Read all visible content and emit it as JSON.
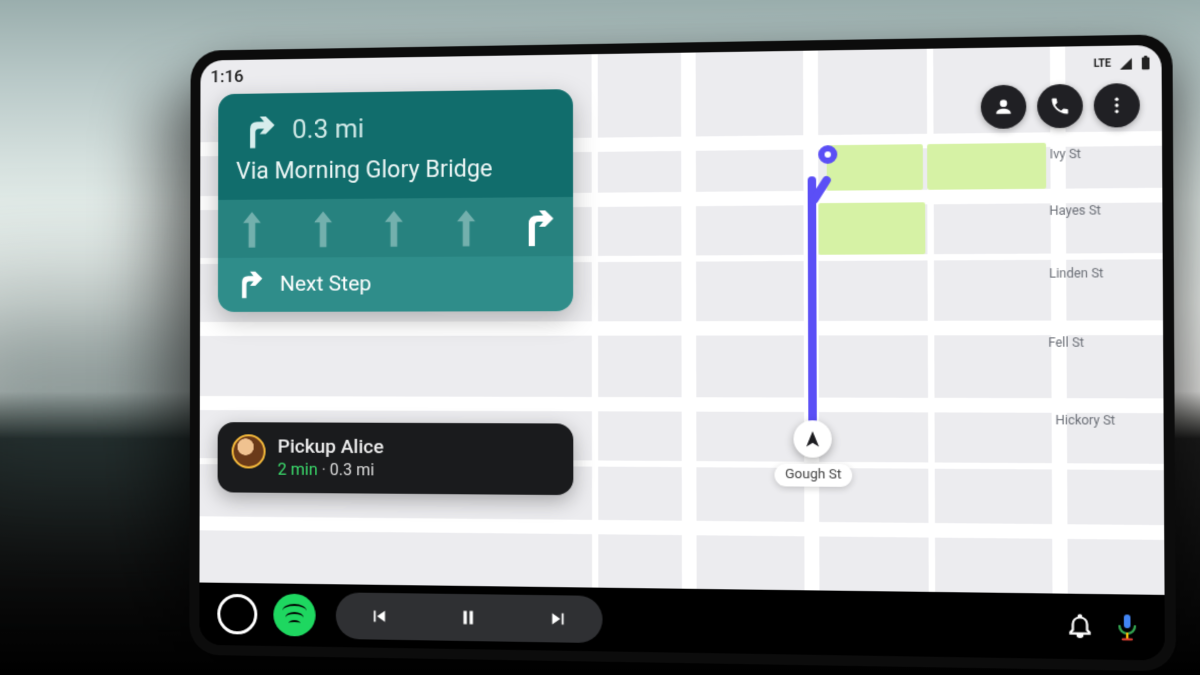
{
  "status": {
    "time": "1:16",
    "network": "LTE"
  },
  "nav": {
    "distance": "0.3 mi",
    "via": "Via Morning Glory Bridge",
    "next_step_label": "Next Step"
  },
  "pickup": {
    "title": "Pickup Alice",
    "eta": "2 min",
    "separator": "·",
    "distance": "0.3 mi"
  },
  "map": {
    "current_street": "Gough St",
    "streets": {
      "ivy": "Ivy St",
      "hayes": "Hayes St",
      "linden": "Linden St",
      "fell": "Fell St",
      "hickory": "Hickory St"
    }
  },
  "icons": {
    "profile": "person-icon",
    "phone": "phone-icon",
    "more": "more-vert-icon",
    "home": "home-circle-icon",
    "spotify": "spotify-icon",
    "prev": "skip-previous-icon",
    "pause": "pause-icon",
    "next": "skip-next-icon",
    "bell": "bell-icon",
    "mic": "mic-icon"
  },
  "colors": {
    "navcard": "#116d6c",
    "route": "#5b4ff6",
    "spotify": "#1ed760",
    "eta": "#3bdc6c"
  }
}
